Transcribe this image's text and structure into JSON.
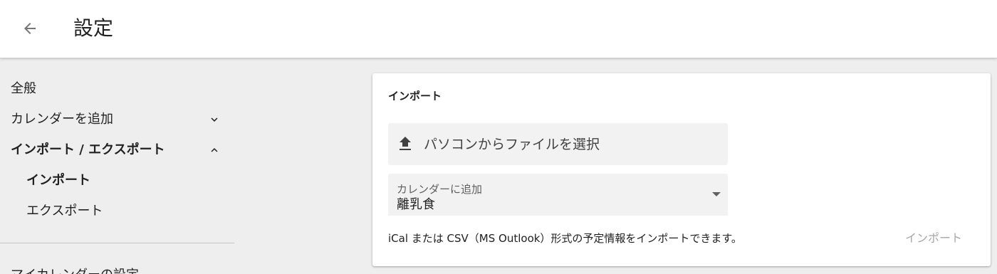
{
  "header": {
    "title": "設定",
    "back_icon": "arrow-back-icon"
  },
  "sidebar": {
    "items": [
      {
        "label": "全般"
      },
      {
        "label": "カレンダーを追加",
        "chevron": "chevron-down-icon"
      },
      {
        "label": "インポート / エクスポート",
        "chevron": "chevron-up-icon"
      },
      {
        "label": "インポート"
      },
      {
        "label": "エクスポート"
      }
    ],
    "partial_item": "マイカレンダーの設定"
  },
  "card": {
    "title": "インポート",
    "file_button_label": "パソコンからファイルを選択",
    "file_button_icon": "upload-icon",
    "calendar_select": {
      "label": "カレンダーに追加",
      "value": "離乳食"
    },
    "description": "iCal または CSV（MS Outlook）形式の予定情報をインポートできます。",
    "import_button_label": "インポート"
  },
  "colors": {
    "background": "#eeeeee",
    "card": "#ffffff",
    "field": "#f2f2f2",
    "disabled_text": "#a6a6a6"
  }
}
